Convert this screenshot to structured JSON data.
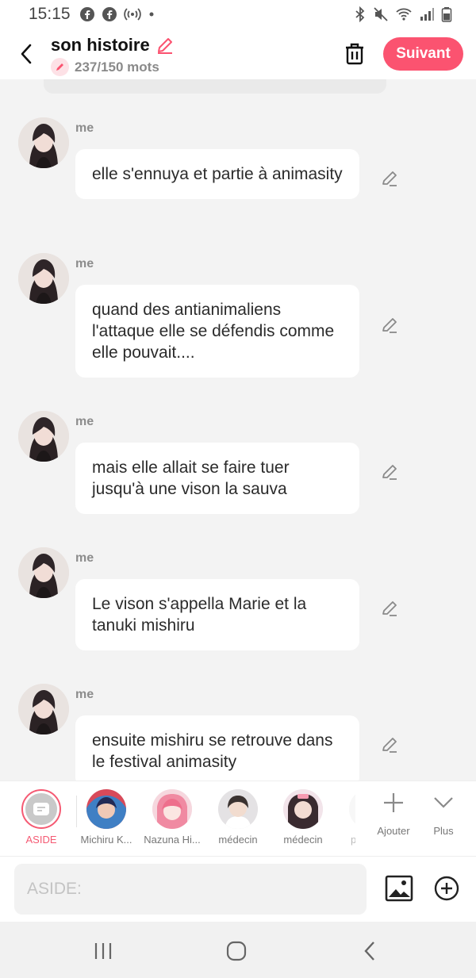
{
  "status_bar": {
    "time": "15:15",
    "icons_left": [
      "facebook-icon",
      "facebook-icon",
      "hotspot-icon",
      "dot-icon"
    ],
    "icons_right": [
      "bluetooth-icon",
      "mute-icon",
      "wifi-icon",
      "signal-icon",
      "battery-icon"
    ]
  },
  "header": {
    "title": "son histoire",
    "word_count": "237/150 mots",
    "next_label": "Suivant",
    "accent_color": "#fb5370"
  },
  "messages": [
    {
      "sender": "me",
      "text": "elle s'ennuya et partie à animasity"
    },
    {
      "sender": "me",
      "text": "quand des antianimaliens l'attaque elle se défendis comme elle pouvait...."
    },
    {
      "sender": "me",
      "text": "mais elle allait se faire tuer jusqu'à une vison la sauva"
    },
    {
      "sender": "me",
      "text": "Le vison s'appella Marie et la tanuki mishiru"
    },
    {
      "sender": "me",
      "text": "ensuite mishiru se retrouve dans le festival animasity"
    }
  ],
  "characters": [
    {
      "name": "ASIDE",
      "selected": true
    },
    {
      "name": "Michiru K..."
    },
    {
      "name": "Nazuna Hi..."
    },
    {
      "name": "médecin"
    },
    {
      "name": "médecin"
    },
    {
      "name": "p"
    }
  ],
  "tools": {
    "add_label": "Ajouter",
    "more_label": "Plus"
  },
  "composer": {
    "placeholder": "ASIDE:"
  }
}
